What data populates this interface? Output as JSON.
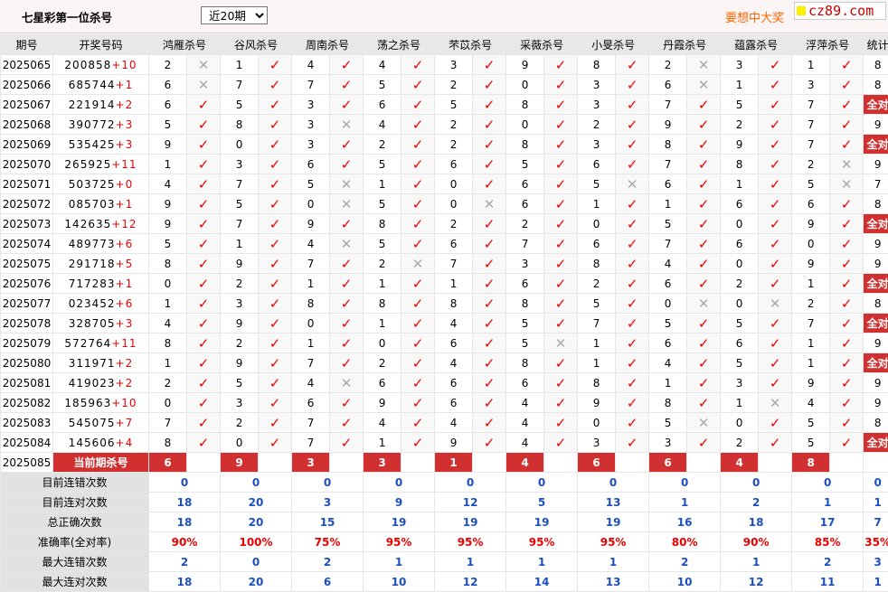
{
  "page": {
    "title": "七星彩第一位杀号",
    "period_select": "近20期",
    "slogan": "要想中大奖",
    "watermark": "cz89.com"
  },
  "table": {
    "headers": [
      "期号",
      "开奖号码",
      "鸿雁杀号",
      "谷风杀号",
      "周南杀号",
      "荡之杀号",
      "芣苡杀号",
      "采薇杀号",
      "小旻杀号",
      "丹霞杀号",
      "蕴露杀号",
      "浮萍杀号",
      "统计"
    ],
    "rows": [
      {
        "period": "2025065",
        "main": "200858",
        "plus": "+10",
        "kills": [
          [
            "2",
            "x"
          ],
          [
            "1",
            "v"
          ],
          [
            "4",
            "v"
          ],
          [
            "4",
            "v"
          ],
          [
            "3",
            "v"
          ],
          [
            "9",
            "v"
          ],
          [
            "8",
            "v"
          ],
          [
            "2",
            "x"
          ],
          [
            "3",
            "v"
          ],
          [
            "1",
            "v"
          ]
        ],
        "count": "8",
        "all": false
      },
      {
        "period": "2025066",
        "main": "685744",
        "plus": "+1",
        "kills": [
          [
            "6",
            "x"
          ],
          [
            "7",
            "v"
          ],
          [
            "7",
            "v"
          ],
          [
            "5",
            "v"
          ],
          [
            "2",
            "v"
          ],
          [
            "0",
            "v"
          ],
          [
            "3",
            "v"
          ],
          [
            "6",
            "x"
          ],
          [
            "1",
            "v"
          ],
          [
            "3",
            "v"
          ]
        ],
        "count": "8",
        "all": false
      },
      {
        "period": "2025067",
        "main": "221914",
        "plus": "+2",
        "kills": [
          [
            "6",
            "v"
          ],
          [
            "5",
            "v"
          ],
          [
            "3",
            "v"
          ],
          [
            "6",
            "v"
          ],
          [
            "5",
            "v"
          ],
          [
            "8",
            "v"
          ],
          [
            "3",
            "v"
          ],
          [
            "7",
            "v"
          ],
          [
            "5",
            "v"
          ],
          [
            "7",
            "v"
          ]
        ],
        "count": "全对",
        "all": true
      },
      {
        "period": "2025068",
        "main": "390772",
        "plus": "+3",
        "kills": [
          [
            "5",
            "v"
          ],
          [
            "8",
            "v"
          ],
          [
            "3",
            "x"
          ],
          [
            "4",
            "v"
          ],
          [
            "2",
            "v"
          ],
          [
            "0",
            "v"
          ],
          [
            "2",
            "v"
          ],
          [
            "9",
            "v"
          ],
          [
            "2",
            "v"
          ],
          [
            "7",
            "v"
          ]
        ],
        "count": "9",
        "all": false
      },
      {
        "period": "2025069",
        "main": "535425",
        "plus": "+3",
        "kills": [
          [
            "9",
            "v"
          ],
          [
            "0",
            "v"
          ],
          [
            "3",
            "v"
          ],
          [
            "2",
            "v"
          ],
          [
            "2",
            "v"
          ],
          [
            "8",
            "v"
          ],
          [
            "3",
            "v"
          ],
          [
            "8",
            "v"
          ],
          [
            "9",
            "v"
          ],
          [
            "7",
            "v"
          ]
        ],
        "count": "全对",
        "all": true
      },
      {
        "period": "2025070",
        "main": "265925",
        "plus": "+11",
        "kills": [
          [
            "1",
            "v"
          ],
          [
            "3",
            "v"
          ],
          [
            "6",
            "v"
          ],
          [
            "5",
            "v"
          ],
          [
            "6",
            "v"
          ],
          [
            "5",
            "v"
          ],
          [
            "6",
            "v"
          ],
          [
            "7",
            "v"
          ],
          [
            "8",
            "v"
          ],
          [
            "2",
            "x"
          ]
        ],
        "count": "9",
        "all": false
      },
      {
        "period": "2025071",
        "main": "503725",
        "plus": "+0",
        "kills": [
          [
            "4",
            "v"
          ],
          [
            "7",
            "v"
          ],
          [
            "5",
            "x"
          ],
          [
            "1",
            "v"
          ],
          [
            "0",
            "v"
          ],
          [
            "6",
            "v"
          ],
          [
            "5",
            "x"
          ],
          [
            "6",
            "v"
          ],
          [
            "1",
            "v"
          ],
          [
            "5",
            "x"
          ]
        ],
        "count": "7",
        "all": false
      },
      {
        "period": "2025072",
        "main": "085703",
        "plus": "+1",
        "kills": [
          [
            "9",
            "v"
          ],
          [
            "5",
            "v"
          ],
          [
            "0",
            "x"
          ],
          [
            "5",
            "v"
          ],
          [
            "0",
            "x"
          ],
          [
            "6",
            "v"
          ],
          [
            "1",
            "v"
          ],
          [
            "1",
            "v"
          ],
          [
            "6",
            "v"
          ],
          [
            "6",
            "v"
          ]
        ],
        "count": "8",
        "all": false
      },
      {
        "period": "2025073",
        "main": "142635",
        "plus": "+12",
        "kills": [
          [
            "9",
            "v"
          ],
          [
            "7",
            "v"
          ],
          [
            "9",
            "v"
          ],
          [
            "8",
            "v"
          ],
          [
            "2",
            "v"
          ],
          [
            "2",
            "v"
          ],
          [
            "0",
            "v"
          ],
          [
            "5",
            "v"
          ],
          [
            "0",
            "v"
          ],
          [
            "9",
            "v"
          ]
        ],
        "count": "全对",
        "all": true
      },
      {
        "period": "2025074",
        "main": "489773",
        "plus": "+6",
        "kills": [
          [
            "5",
            "v"
          ],
          [
            "1",
            "v"
          ],
          [
            "4",
            "x"
          ],
          [
            "5",
            "v"
          ],
          [
            "6",
            "v"
          ],
          [
            "7",
            "v"
          ],
          [
            "6",
            "v"
          ],
          [
            "7",
            "v"
          ],
          [
            "6",
            "v"
          ],
          [
            "0",
            "v"
          ]
        ],
        "count": "9",
        "all": false
      },
      {
        "period": "2025075",
        "main": "291718",
        "plus": "+5",
        "kills": [
          [
            "8",
            "v"
          ],
          [
            "9",
            "v"
          ],
          [
            "7",
            "v"
          ],
          [
            "2",
            "x"
          ],
          [
            "7",
            "v"
          ],
          [
            "3",
            "v"
          ],
          [
            "8",
            "v"
          ],
          [
            "4",
            "v"
          ],
          [
            "0",
            "v"
          ],
          [
            "9",
            "v"
          ]
        ],
        "count": "9",
        "all": false
      },
      {
        "period": "2025076",
        "main": "717283",
        "plus": "+1",
        "kills": [
          [
            "0",
            "v"
          ],
          [
            "2",
            "v"
          ],
          [
            "1",
            "v"
          ],
          [
            "1",
            "v"
          ],
          [
            "1",
            "v"
          ],
          [
            "6",
            "v"
          ],
          [
            "2",
            "v"
          ],
          [
            "6",
            "v"
          ],
          [
            "2",
            "v"
          ],
          [
            "1",
            "v"
          ]
        ],
        "count": "全对",
        "all": true
      },
      {
        "period": "2025077",
        "main": "023452",
        "plus": "+6",
        "kills": [
          [
            "1",
            "v"
          ],
          [
            "3",
            "v"
          ],
          [
            "8",
            "v"
          ],
          [
            "8",
            "v"
          ],
          [
            "8",
            "v"
          ],
          [
            "8",
            "v"
          ],
          [
            "5",
            "v"
          ],
          [
            "0",
            "x"
          ],
          [
            "0",
            "x"
          ],
          [
            "2",
            "v"
          ]
        ],
        "count": "8",
        "all": false
      },
      {
        "period": "2025078",
        "main": "328705",
        "plus": "+3",
        "kills": [
          [
            "4",
            "v"
          ],
          [
            "9",
            "v"
          ],
          [
            "0",
            "v"
          ],
          [
            "1",
            "v"
          ],
          [
            "4",
            "v"
          ],
          [
            "5",
            "v"
          ],
          [
            "7",
            "v"
          ],
          [
            "5",
            "v"
          ],
          [
            "5",
            "v"
          ],
          [
            "7",
            "v"
          ]
        ],
        "count": "全对",
        "all": true
      },
      {
        "period": "2025079",
        "main": "572764",
        "plus": "+11",
        "kills": [
          [
            "8",
            "v"
          ],
          [
            "2",
            "v"
          ],
          [
            "1",
            "v"
          ],
          [
            "0",
            "v"
          ],
          [
            "6",
            "v"
          ],
          [
            "5",
            "x"
          ],
          [
            "1",
            "v"
          ],
          [
            "6",
            "v"
          ],
          [
            "6",
            "v"
          ],
          [
            "1",
            "v"
          ]
        ],
        "count": "9",
        "all": false
      },
      {
        "period": "2025080",
        "main": "311971",
        "plus": "+2",
        "kills": [
          [
            "1",
            "v"
          ],
          [
            "9",
            "v"
          ],
          [
            "7",
            "v"
          ],
          [
            "2",
            "v"
          ],
          [
            "4",
            "v"
          ],
          [
            "8",
            "v"
          ],
          [
            "1",
            "v"
          ],
          [
            "4",
            "v"
          ],
          [
            "5",
            "v"
          ],
          [
            "1",
            "v"
          ]
        ],
        "count": "全对",
        "all": true
      },
      {
        "period": "2025081",
        "main": "419023",
        "plus": "+2",
        "kills": [
          [
            "2",
            "v"
          ],
          [
            "5",
            "v"
          ],
          [
            "4",
            "x"
          ],
          [
            "6",
            "v"
          ],
          [
            "6",
            "v"
          ],
          [
            "6",
            "v"
          ],
          [
            "8",
            "v"
          ],
          [
            "1",
            "v"
          ],
          [
            "3",
            "v"
          ],
          [
            "9",
            "v"
          ]
        ],
        "count": "9",
        "all": false
      },
      {
        "period": "2025082",
        "main": "185963",
        "plus": "+10",
        "kills": [
          [
            "0",
            "v"
          ],
          [
            "3",
            "v"
          ],
          [
            "6",
            "v"
          ],
          [
            "9",
            "v"
          ],
          [
            "6",
            "v"
          ],
          [
            "4",
            "v"
          ],
          [
            "9",
            "v"
          ],
          [
            "8",
            "v"
          ],
          [
            "1",
            "x"
          ],
          [
            "4",
            "v"
          ]
        ],
        "count": "9",
        "all": false
      },
      {
        "period": "2025083",
        "main": "545075",
        "plus": "+7",
        "kills": [
          [
            "7",
            "v"
          ],
          [
            "2",
            "v"
          ],
          [
            "7",
            "v"
          ],
          [
            "4",
            "v"
          ],
          [
            "4",
            "v"
          ],
          [
            "4",
            "v"
          ],
          [
            "0",
            "v"
          ],
          [
            "5",
            "x"
          ],
          [
            "0",
            "v"
          ],
          [
            "5",
            "v"
          ]
        ],
        "count": "8",
        "all": false
      },
      {
        "period": "2025084",
        "main": "145606",
        "plus": "+4",
        "kills": [
          [
            "8",
            "v"
          ],
          [
            "0",
            "v"
          ],
          [
            "7",
            "v"
          ],
          [
            "1",
            "v"
          ],
          [
            "9",
            "v"
          ],
          [
            "4",
            "v"
          ],
          [
            "3",
            "v"
          ],
          [
            "3",
            "v"
          ],
          [
            "2",
            "v"
          ],
          [
            "5",
            "v"
          ]
        ],
        "count": "全对",
        "all": true
      }
    ],
    "current": {
      "period": "2025085",
      "label": "当前期杀号",
      "values": [
        "6",
        "9",
        "3",
        "3",
        "1",
        "4",
        "6",
        "6",
        "4",
        "8"
      ]
    },
    "stats": [
      {
        "label": "目前连错次数",
        "values": [
          "0",
          "0",
          "0",
          "0",
          "0",
          "0",
          "0",
          "0",
          "0",
          "0"
        ],
        "total": "0",
        "kind": "stat"
      },
      {
        "label": "目前连对次数",
        "values": [
          "18",
          "20",
          "3",
          "9",
          "12",
          "5",
          "13",
          "1",
          "2",
          "1"
        ],
        "total": "1",
        "kind": "stat"
      },
      {
        "label": "总正确次数",
        "values": [
          "18",
          "20",
          "15",
          "19",
          "19",
          "19",
          "19",
          "16",
          "18",
          "17"
        ],
        "total": "7",
        "kind": "stat"
      },
      {
        "label": "准确率(全对率)",
        "values": [
          "90%",
          "100%",
          "75%",
          "95%",
          "95%",
          "95%",
          "95%",
          "80%",
          "90%",
          "85%"
        ],
        "total": "35%",
        "kind": "pct"
      },
      {
        "label": "最大连错次数",
        "values": [
          "2",
          "0",
          "2",
          "1",
          "1",
          "1",
          "1",
          "2",
          "1",
          "2"
        ],
        "total": "3",
        "kind": "stat"
      },
      {
        "label": "最大连对次数",
        "values": [
          "18",
          "20",
          "6",
          "10",
          "12",
          "14",
          "13",
          "10",
          "12",
          "11"
        ],
        "total": "1",
        "kind": "stat"
      }
    ],
    "marks": {
      "v": "✓",
      "x": "✕"
    }
  }
}
